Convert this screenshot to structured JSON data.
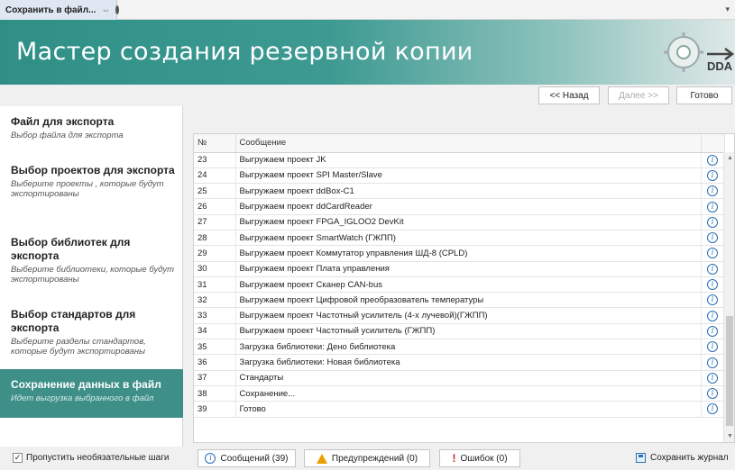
{
  "tab": {
    "title": "Сохранить в файл...",
    "pin": "⇔"
  },
  "banner": {
    "title": "Мастер создания резервной копии",
    "logo_text": "DDA"
  },
  "nav": {
    "back": "<< Назад",
    "next": "Далее >>",
    "done": "Готово"
  },
  "steps": [
    {
      "title": "Файл для экспорта",
      "desc": "Выбор файла для экспорта"
    },
    {
      "title": "Выбор проектов для экспорта",
      "desc": "Выберите проекты , которые будут экспортированы"
    },
    {
      "title": "Выбор библиотек для экспорта",
      "desc": "Выберите библиотеки, которые будут экспортированы"
    },
    {
      "title": "Выбор стандартов для экспорта",
      "desc": "Выберите разделы стандартов, которые будут экспортированы"
    },
    {
      "title": "Сохранение данных в файл",
      "desc": "Идет выгрузка выбранного в файл"
    }
  ],
  "active_step_index": 4,
  "grid": {
    "headers": [
      "№",
      "Сообщение",
      ""
    ],
    "rows": [
      {
        "num": "23",
        "msg": "Выгружаем проект JK"
      },
      {
        "num": "24",
        "msg": "Выгружаем проект SPI Master/Slave"
      },
      {
        "num": "25",
        "msg": "Выгружаем проект ddBox-C1"
      },
      {
        "num": "26",
        "msg": "Выгружаем проект ddCardReader"
      },
      {
        "num": "27",
        "msg": "Выгружаем проект FPGA_IGLOO2 DevKit"
      },
      {
        "num": "28",
        "msg": "Выгружаем проект SmartWatch (ГЖПП)"
      },
      {
        "num": "29",
        "msg": "Выгружаем проект Коммутатор управления ШД-8 (CPLD)"
      },
      {
        "num": "30",
        "msg": "Выгружаем проект Плата управления"
      },
      {
        "num": "31",
        "msg": "Выгружаем проект Сканер CAN-bus"
      },
      {
        "num": "32",
        "msg": "Выгружаем проект Цифровой преобразователь температуры"
      },
      {
        "num": "33",
        "msg": "Выгружаем проект Частотный усилитель (4-х лучевой)(ГЖПП)"
      },
      {
        "num": "34",
        "msg": "Выгружаем проект Частотный усилитель (ГЖПП)"
      },
      {
        "num": "35",
        "msg": "Загрузка библиотеки: Дено библиотека"
      },
      {
        "num": "36",
        "msg": "Загрузка библиотеки: Новая библиотека"
      },
      {
        "num": "37",
        "msg": "Стандарты"
      },
      {
        "num": "38",
        "msg": "Сохранение..."
      },
      {
        "num": "39",
        "msg": "Готово"
      }
    ]
  },
  "bottom": {
    "skip_label": "Пропустить необязательные шаги",
    "skip_checked": true,
    "messages": "Сообщений (39)",
    "warnings": "Предупреждений (0)",
    "errors": "Ошибок (0)",
    "save_log": "Сохранить журнал"
  }
}
